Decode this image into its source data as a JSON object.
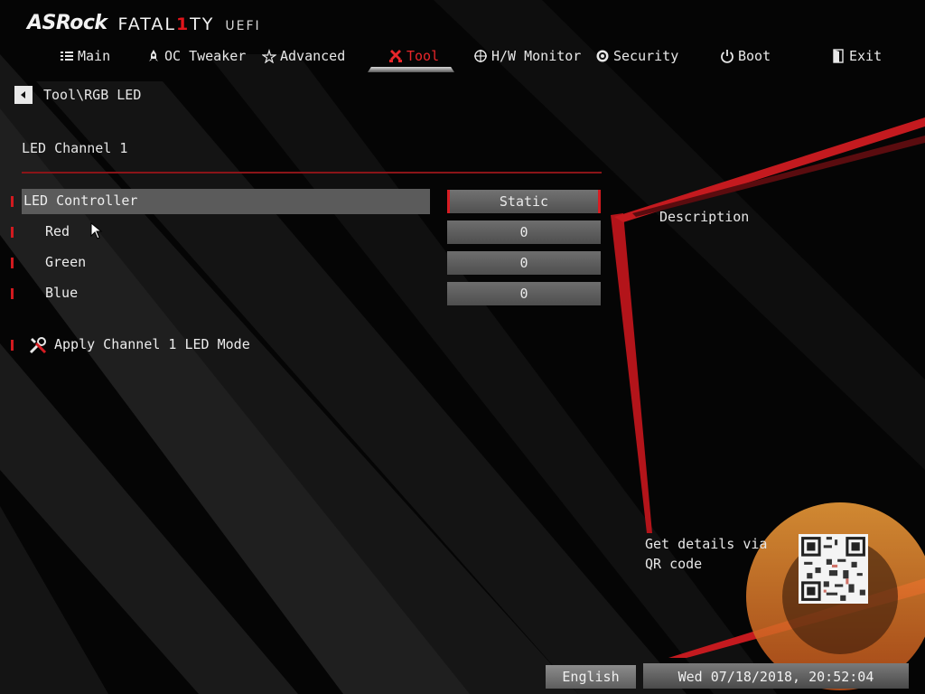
{
  "brand": {
    "name": "ASRock",
    "series_pre": "FATAL",
    "series_one": "1",
    "series_post": "TY",
    "suffix": "UEFI"
  },
  "tabs": [
    {
      "label": "Main",
      "icon": "list-icon"
    },
    {
      "label": "OC Tweaker",
      "icon": "rocket-icon"
    },
    {
      "label": "Advanced",
      "icon": "star-icon"
    },
    {
      "label": "Tool",
      "icon": "tools-icon",
      "active": true
    },
    {
      "label": "H/W Monitor",
      "icon": "crosshair-icon"
    },
    {
      "label": "Security",
      "icon": "shield-gear-icon"
    },
    {
      "label": "Boot",
      "icon": "power-icon"
    },
    {
      "label": "Exit",
      "icon": "exit-door-icon"
    }
  ],
  "breadcrumb": "Tool\\RGB LED",
  "section_title": "LED Channel 1",
  "settings": [
    {
      "label": "LED Controller",
      "value": "Static",
      "selected": true
    },
    {
      "label": "Red",
      "value": "0"
    },
    {
      "label": "Green",
      "value": "0"
    },
    {
      "label": "Blue",
      "value": "0"
    }
  ],
  "apply_label": "Apply Channel 1 LED Mode",
  "description_title": "Description",
  "qr_text": "Get details via QR code",
  "language": "English",
  "datetime": "Wed 07/18/2018, 20:52:04",
  "colors": {
    "accent": "#e0151b",
    "selected_row": "#5b5b5b",
    "value_box": "#5e5e5e",
    "background": "#050505"
  }
}
